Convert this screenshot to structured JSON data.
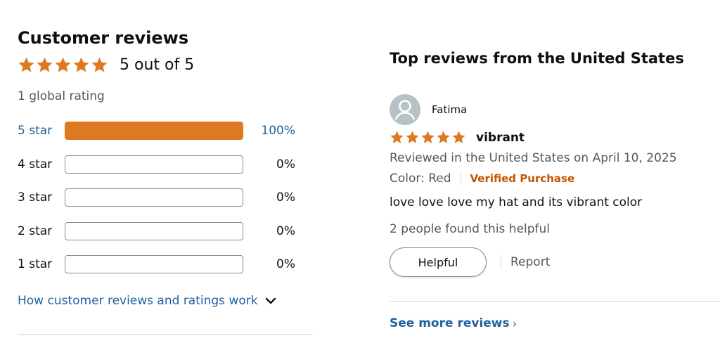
{
  "summary": {
    "title": "Customer reviews",
    "stars": 5,
    "rating_text": "5 out of 5",
    "global_rating": "1 global rating",
    "histogram": [
      {
        "label": "5 star",
        "percent": "100%",
        "fraction": 1.0
      },
      {
        "label": "4 star",
        "percent": "0%",
        "fraction": 0
      },
      {
        "label": "3 star",
        "percent": "0%",
        "fraction": 0
      },
      {
        "label": "2 star",
        "percent": "0%",
        "fraction": 0
      },
      {
        "label": "1 star",
        "percent": "0%",
        "fraction": 0
      }
    ],
    "how_link": "How customer reviews and ratings work"
  },
  "reviews": {
    "title": "Top reviews from the United States",
    "items": [
      {
        "author": "Fatima",
        "stars": 5,
        "headline": "vibrant",
        "date_line": "Reviewed in the United States on April 10, 2025",
        "variant": "Color: Red",
        "verified": "Verified Purchase",
        "body": "love love love my hat and its vibrant color",
        "helpful_count": "2 people found this helpful",
        "helpful_button": "Helpful",
        "report_label": "Report"
      }
    ],
    "see_more": "See more reviews",
    "see_more_chevron": "›"
  },
  "colors": {
    "star": "#de7921",
    "link": "#2162a1",
    "verified": "#c45500",
    "divider": "#d5d9d9"
  },
  "icons": {
    "star": "star-icon",
    "chevron_down": "chevron-down-icon",
    "avatar": "default-avatar-icon"
  }
}
